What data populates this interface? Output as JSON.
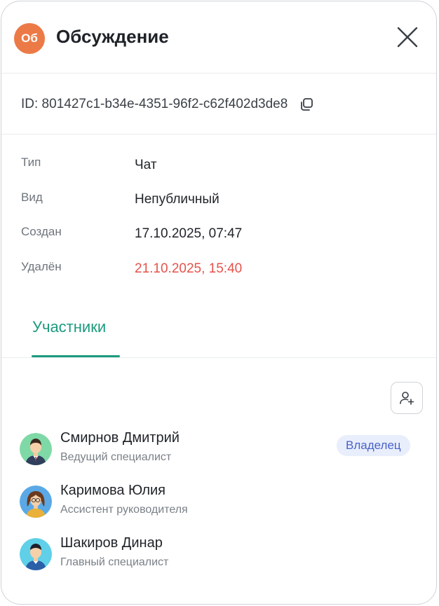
{
  "header": {
    "avatar_initials": "Об",
    "avatar_color": "#ec7a46",
    "title": "Обсуждение",
    "close_icon": "close-icon"
  },
  "id_row": {
    "text": "ID: 801427c1-b34e-4351-96f2-c62f402d3de8",
    "copy_icon": "copy-icon"
  },
  "properties": [
    {
      "label": "Тип",
      "value": "Чат"
    },
    {
      "label": "Вид",
      "value": "Непубличный"
    },
    {
      "label": "Создан",
      "value": "17.10.2025, 07:47"
    },
    {
      "label": "Удалён",
      "value": "21.10.2025, 15:40"
    }
  ],
  "colors": {
    "accent": "#1c9a7e",
    "deleted": "#e5534b",
    "owner_badge_bg": "#e9eefc",
    "owner_badge_text": "#4a63c7"
  },
  "tabs": [
    {
      "label": "Участники",
      "active": true
    }
  ],
  "add_member_icon": "add-user-icon",
  "members": [
    {
      "name": "Смирнов Дмитрий",
      "role": "Ведущий специалист",
      "badge": "Владелец",
      "avatar_icon": "man-suit-avatar"
    },
    {
      "name": "Каримова Юлия",
      "role": "Ассистент руководителя",
      "badge": null,
      "avatar_icon": "woman-avatar"
    },
    {
      "name": "Шакиров Динар",
      "role": "Главный специалист",
      "badge": null,
      "avatar_icon": "man-avatar"
    }
  ]
}
